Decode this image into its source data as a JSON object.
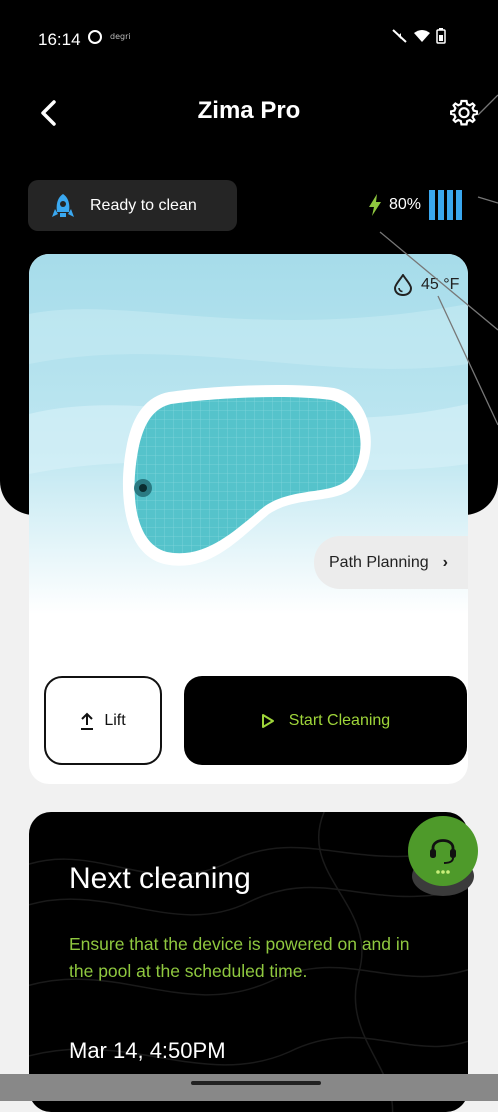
{
  "status_bar": {
    "time": "16:14",
    "carrier": "degri",
    "icons": [
      "do-not-disturb-icon",
      "mute-icon",
      "wifi-icon",
      "battery-icon"
    ]
  },
  "header": {
    "title": "Zima Pro",
    "back_icon": "chevron-left-icon",
    "settings_icon": "gear-icon"
  },
  "device_status": {
    "label": "Ready to clean",
    "icon": "robot-icon",
    "battery_percent": "80%",
    "battery_level": 0.8,
    "battery_color": "#3aa8f0",
    "charging_color": "#8fc83f"
  },
  "pool_card": {
    "temperature": "45 °F",
    "temp_icon": "water-drop-icon",
    "path_planning_label": "Path Planning",
    "lift_label": "Lift",
    "start_label": "Start Cleaning",
    "accent_color": "#9fd53a"
  },
  "next_cleaning": {
    "title": "Next cleaning",
    "description": "Ensure that the device is powered on and in the pool at the scheduled time.",
    "date": "Mar 14, 4:50PM"
  },
  "support": {
    "icon": "headset-icon",
    "color": "#4e9a2a"
  }
}
